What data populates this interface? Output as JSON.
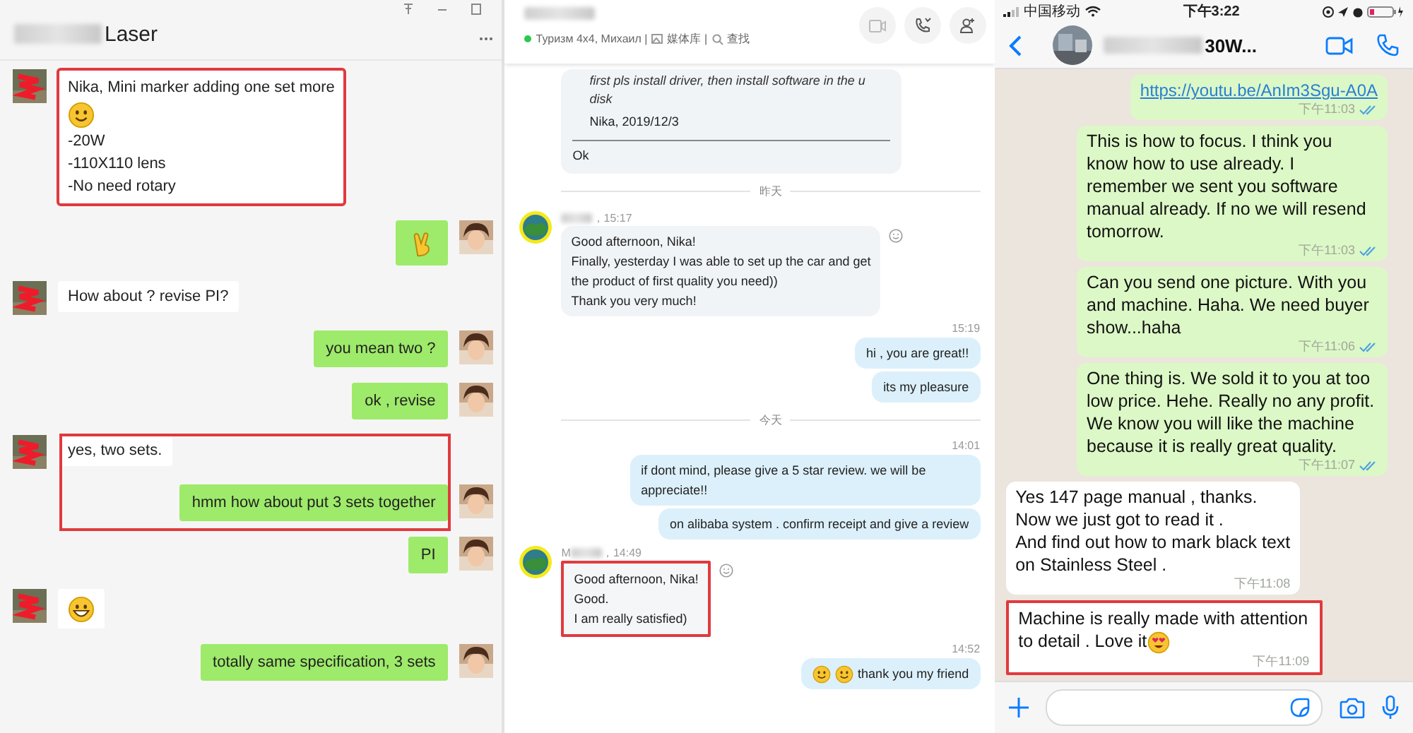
{
  "wechat": {
    "title": "Laser",
    "messages": [
      {
        "outgoing": false,
        "highlighted": true,
        "parts": [
          {
            "kind": "text",
            "text": "Nika,  Mini marker adding one set more"
          },
          {
            "kind": "smile"
          },
          {
            "kind": "text",
            "text": "-20W"
          },
          {
            "kind": "text",
            "text": "-110X110 lens"
          },
          {
            "kind": "text",
            "text": "-No need rotary"
          }
        ]
      },
      {
        "outgoing": true,
        "highlighted": false,
        "parts": [
          {
            "kind": "victory"
          }
        ]
      },
      {
        "outgoing": false,
        "highlighted": false,
        "parts": [
          {
            "kind": "text",
            "text": "How about ?  revise PI?"
          }
        ]
      },
      {
        "outgoing": true,
        "highlighted": false,
        "parts": [
          {
            "kind": "text",
            "text": "you mean two ?"
          }
        ]
      },
      {
        "outgoing": true,
        "highlighted": false,
        "parts": [
          {
            "kind": "text",
            "text": "ok , revise"
          }
        ]
      },
      {
        "outgoing": false,
        "highlighted": true,
        "parts": [
          {
            "kind": "text",
            "text": "yes, two sets."
          }
        ]
      },
      {
        "outgoing": true,
        "highlighted": true,
        "parts": [
          {
            "kind": "text",
            "text": "hmm how about put 3 sets together"
          }
        ]
      },
      {
        "outgoing": true,
        "highlighted": false,
        "parts": [
          {
            "kind": "text",
            "text": "PI"
          }
        ]
      },
      {
        "outgoing": false,
        "highlighted": false,
        "parts": [
          {
            "kind": "grin"
          }
        ]
      },
      {
        "outgoing": true,
        "highlighted": false,
        "parts": [
          {
            "kind": "text",
            "text": "totally same specification, 3 sets"
          }
        ]
      }
    ]
  },
  "skype": {
    "status": "Туризм 4x4, Михаил |",
    "media": "媒体库 |",
    "search": "查找",
    "items": [
      {
        "kind": "quote",
        "quote": [
          "first pls install driver, then install software in the u",
          "disk"
        ],
        "signature": "Nika, 2019/12/3",
        "reply": "Ok"
      },
      {
        "kind": "divider",
        "text": "昨天"
      },
      {
        "kind": "incoming",
        "time": "，15:17",
        "highlighted": false,
        "lines": [
          "Good afternoon, Nika!",
          "Finally, yesterday I was able to set up the car and get",
          "the product of first quality you need))",
          "Thank you very much!"
        ]
      },
      {
        "kind": "outgoing",
        "time": "15:19",
        "bubbles": [
          {
            "text": "hi , you are great!!"
          },
          {
            "text": "its my pleasure"
          }
        ]
      },
      {
        "kind": "divider",
        "text": "今天"
      },
      {
        "kind": "outgoing",
        "time": "14:01",
        "bubbles": [
          {
            "text": "if dont mind, please give a 5 star review. we will be appreciate!!"
          },
          {
            "text": "on alibaba system . confirm receipt and give a review"
          }
        ]
      },
      {
        "kind": "incoming",
        "sender": "M",
        "time": "，14:49",
        "highlighted": true,
        "lines": [
          "Good afternoon, Nika!",
          "Good.",
          "I am really satisfied)"
        ]
      },
      {
        "kind": "outgoing",
        "time": "14:52",
        "bubbles": [
          {
            "emoji": [
              {
                "kind": "smile"
              },
              {
                "kind": "smile"
              }
            ],
            "text": "thank you my friend"
          }
        ]
      }
    ]
  },
  "whatsapp": {
    "carrier": "中国移动",
    "clock": "下午3:22",
    "title": "30W...",
    "messages": [
      {
        "outgoing": true,
        "kind": "link",
        "lines": [
          "https://youtu.be/AnIm3Sgu-A0A"
        ],
        "time": "下午11:03",
        "read": true,
        "highlighted": false
      },
      {
        "outgoing": true,
        "kind": "text",
        "lines": [
          "This is how to focus. I think you know how to use already. I remember we sent you software manual already. If no we will resend tomorrow."
        ],
        "time": "下午11:03",
        "read": true,
        "highlighted": false
      },
      {
        "outgoing": true,
        "kind": "text",
        "lines": [
          "Can you send one picture. With you and machine. Haha. We need buyer show...haha"
        ],
        "time": "下午11:06",
        "read": true,
        "highlighted": false
      },
      {
        "outgoing": true,
        "kind": "text",
        "lines": [
          "One thing is. We sold it to you at too low price. Hehe. Really no any profit. We know you will like the machine because it is really great quality."
        ],
        "time": "下午11:07",
        "read": true,
        "highlighted": false
      },
      {
        "outgoing": false,
        "kind": "text",
        "lines": [
          "Yes 147 page manual , thanks.",
          "Now we just got to read it .",
          "And find out how to mark black text",
          "on Stainless Steel ."
        ],
        "time": "下午11:08",
        "read": false,
        "highlighted": false
      },
      {
        "outgoing": false,
        "kind": "text",
        "lines": [
          "Machine is really made with attention to detail . Love it"
        ],
        "emoji": {
          "kind": "heart-eyes"
        },
        "time": "下午11:09",
        "read": false,
        "highlighted": true
      }
    ]
  }
}
